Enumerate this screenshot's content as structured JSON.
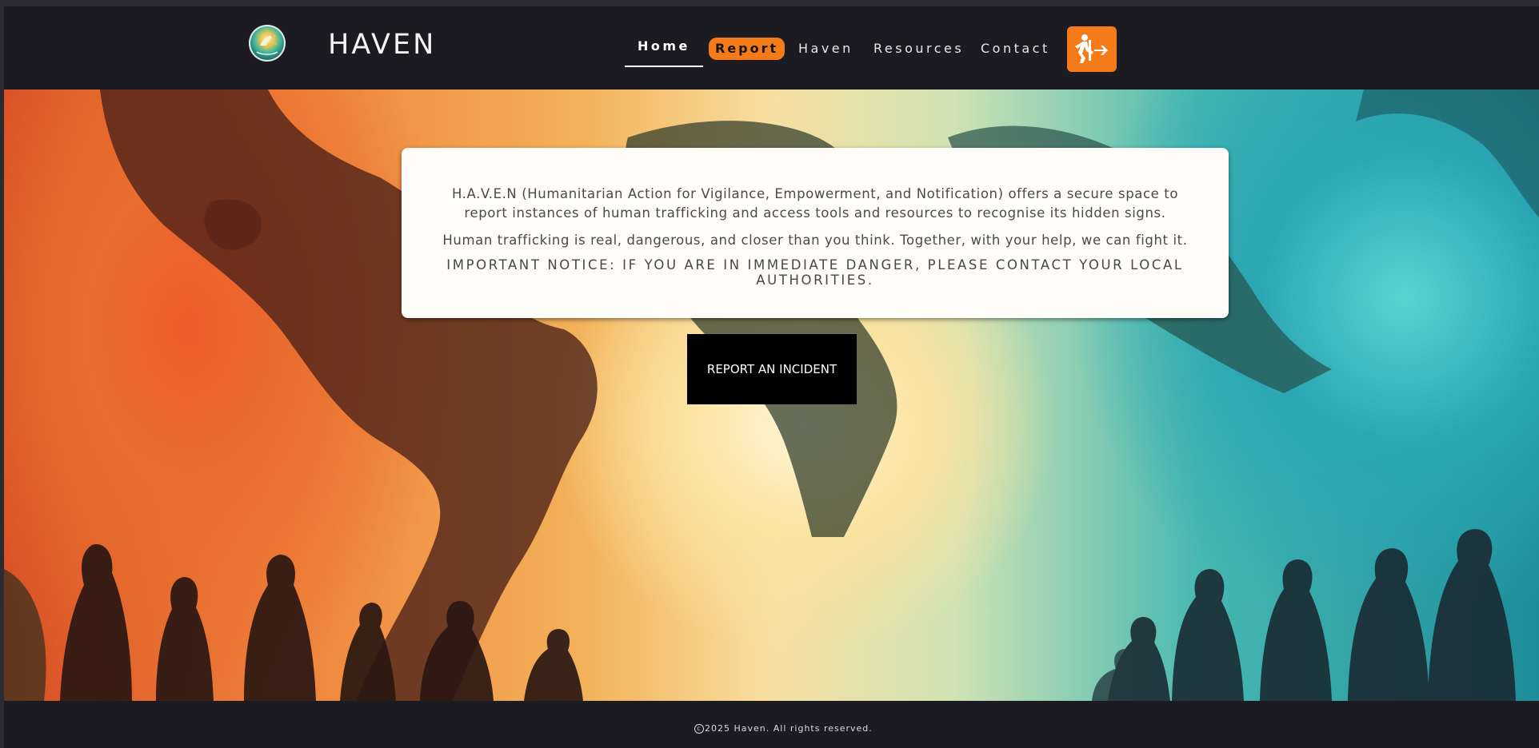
{
  "header": {
    "brand": "HAVEN",
    "nav": {
      "home": "Home",
      "report": "Report",
      "haven": "Haven",
      "resources": "Resources",
      "contact": "Contact"
    }
  },
  "hero": {
    "intro": "H.A.V.E.N (Humanitarian Action for Vigilance, Empowerment, and Notification) offers a secure space to report instances of human trafficking and access tools and resources to recognise its hidden signs.",
    "statement": "Human trafficking is real, dangerous, and closer than you think. Together, with your help, we can fight it.",
    "notice": "IMPORTANT NOTICE: IF YOU ARE IN IMMEDIATE DANGER, PLEASE CONTACT YOUR LOCAL AUTHORITIES.",
    "cta_label": "REPORT AN INCIDENT"
  },
  "footer": {
    "copyright": "2025 Haven. All rights reserved."
  },
  "colors": {
    "accent": "#f57b18",
    "header_bg": "#1c1b21",
    "cta_bg": "#000000"
  },
  "icons": {
    "logo": "haven-logo",
    "exit": "quick-exit-icon"
  }
}
